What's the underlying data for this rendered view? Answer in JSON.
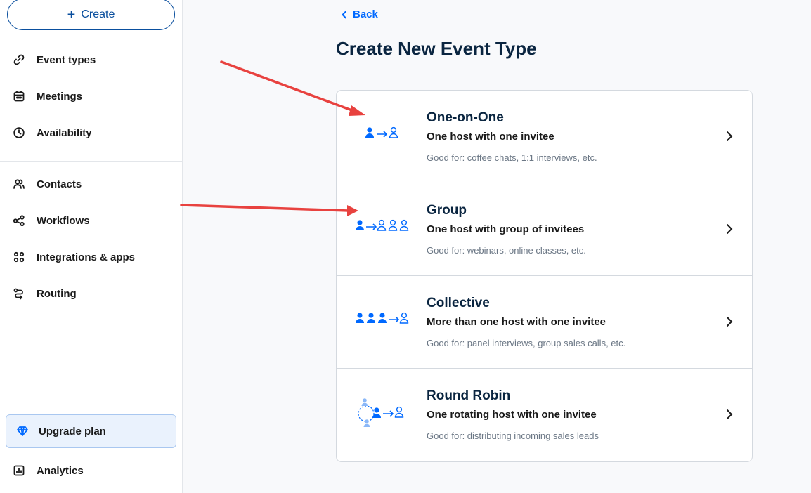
{
  "sidebar": {
    "create_label": "Create",
    "items": [
      {
        "label": "Event types",
        "icon": "link-icon"
      },
      {
        "label": "Meetings",
        "icon": "calendar-icon"
      },
      {
        "label": "Availability",
        "icon": "clock-icon"
      },
      {
        "label": "Contacts",
        "icon": "contacts-icon"
      },
      {
        "label": "Workflows",
        "icon": "workflow-icon"
      },
      {
        "label": "Integrations & apps",
        "icon": "grid-icon"
      },
      {
        "label": "Routing",
        "icon": "routing-icon"
      }
    ],
    "upgrade_label": "Upgrade plan",
    "analytics_label": "Analytics"
  },
  "main": {
    "back_label": "Back",
    "title": "Create New Event Type",
    "event_types": [
      {
        "name": "One-on-One",
        "description": "One host with one invitee",
        "good_for": "Good for: coffee chats, 1:1 interviews, etc."
      },
      {
        "name": "Group",
        "description": "One host with group of invitees",
        "good_for": "Good for: webinars, online classes, etc."
      },
      {
        "name": "Collective",
        "description": "More than one host with one invitee",
        "good_for": "Good for: panel interviews, group sales calls, etc."
      },
      {
        "name": "Round Robin",
        "description": "One rotating host with one invitee",
        "good_for": "Good for: distributing incoming sales leads"
      }
    ]
  },
  "colors": {
    "accent": "#0069ff",
    "annotation_arrow": "#e8423f",
    "title_text": "#0a2540"
  }
}
